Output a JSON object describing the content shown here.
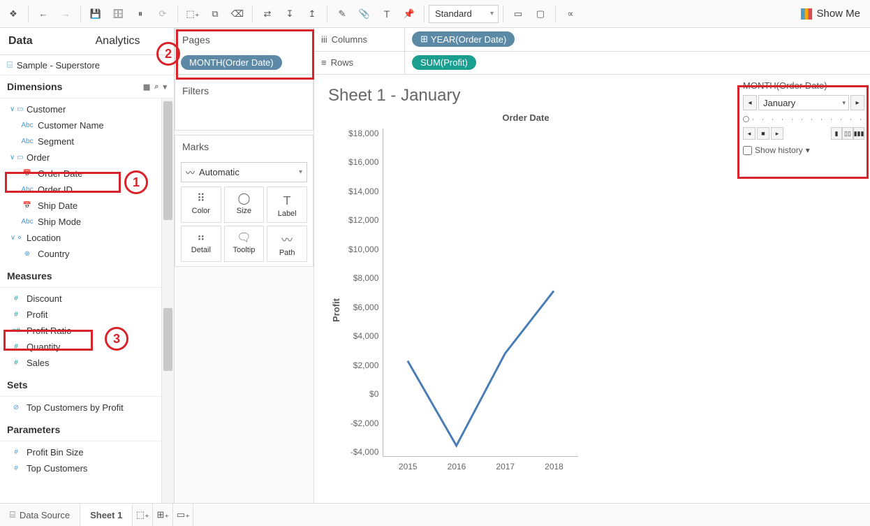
{
  "toolbar": {
    "fit_mode": "Standard",
    "showme_label": "Show Me"
  },
  "data_pane": {
    "tabs": {
      "data": "Data",
      "analytics": "Analytics"
    },
    "datasource": "Sample - Superstore",
    "dimensions_title": "Dimensions",
    "measures_title": "Measures",
    "sets_title": "Sets",
    "parameters_title": "Parameters",
    "dimensions": {
      "customer": "Customer",
      "customer_name": "Customer Name",
      "segment": "Segment",
      "order": "Order",
      "order_date": "Order Date",
      "order_id": "Order ID",
      "ship_date": "Ship Date",
      "ship_mode": "Ship Mode",
      "location": "Location",
      "country": "Country"
    },
    "measures": {
      "discount": "Discount",
      "profit": "Profit",
      "profit_ratio": "Profit Ratio",
      "quantity": "Quantity",
      "sales": "Sales"
    },
    "sets": {
      "top_customers": "Top Customers by Profit"
    },
    "parameters": {
      "profit_bin": "Profit Bin Size",
      "top_customers": "Top Customers"
    }
  },
  "shelves": {
    "pages_title": "Pages",
    "pages_pill": "MONTH(Order Date)",
    "filters_title": "Filters",
    "marks_title": "Marks",
    "marks_type": "Automatic",
    "marks_cells": {
      "color": "Color",
      "size": "Size",
      "label": "Label",
      "detail": "Detail",
      "tooltip": "Tooltip",
      "path": "Path"
    }
  },
  "colrow": {
    "columns_label": "Columns",
    "rows_label": "Rows",
    "columns_pill": "YEAR(Order Date)",
    "rows_pill": "SUM(Profit)"
  },
  "viz": {
    "title": "Sheet 1 - January",
    "x_axis_title": "Order Date",
    "y_axis_title": "Profit",
    "y_ticks": [
      "$18,000",
      "$16,000",
      "$14,000",
      "$12,000",
      "$10,000",
      "$8,000",
      "$6,000",
      "$4,000",
      "$2,000",
      "$0",
      "-$2,000",
      "-$4,000"
    ],
    "x_ticks": [
      "2015",
      "2016",
      "2017",
      "2018"
    ]
  },
  "page_control": {
    "title": "MONTH(Order Date)",
    "current": "January",
    "history_label": "Show history"
  },
  "bottom": {
    "datasource": "Data Source",
    "sheet1": "Sheet 1"
  },
  "annotations": {
    "n1": "1",
    "n2": "2",
    "n3": "3"
  },
  "chart_data": {
    "type": "line",
    "title": "Sheet 1 - January",
    "xlabel": "Order Date",
    "ylabel": "Profit",
    "ylim": [
      -4000,
      18000
    ],
    "categories": [
      "2015",
      "2016",
      "2017",
      "2018"
    ],
    "values": [
      2400,
      -3300,
      2900,
      7100
    ]
  }
}
